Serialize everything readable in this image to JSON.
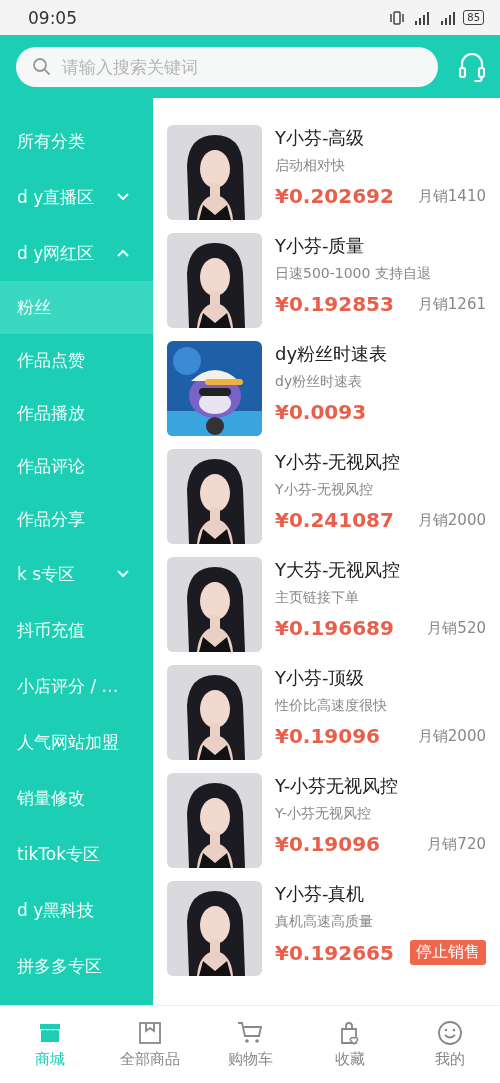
{
  "status_bar": {
    "time": "09:05",
    "battery": "85"
  },
  "search": {
    "placeholder": "请输入搜索关键词"
  },
  "sidebar": {
    "items": [
      {
        "label": "所有分类",
        "selected": false
      },
      {
        "label": "d y直播区",
        "selected": false,
        "expanded": false
      },
      {
        "label": "d y网红区",
        "selected": false,
        "expanded": true,
        "children": [
          {
            "label": "粉丝",
            "selected": true
          },
          {
            "label": "作品点赞",
            "selected": false
          },
          {
            "label": "作品播放",
            "selected": false
          },
          {
            "label": "作品评论",
            "selected": false
          },
          {
            "label": "作品分享",
            "selected": false
          }
        ]
      },
      {
        "label": "k s专区",
        "selected": false,
        "expanded": false
      },
      {
        "label": "抖币充值",
        "selected": false
      },
      {
        "label": "小店评分 / …",
        "selected": false
      },
      {
        "label": "人气网站加盟",
        "selected": false
      },
      {
        "label": "销量修改",
        "selected": false
      },
      {
        "label": "tikTok专区",
        "selected": false
      },
      {
        "label": "d y黑科技",
        "selected": false
      },
      {
        "label": "拼多多专区",
        "selected": false
      }
    ]
  },
  "products": [
    {
      "title": "Y小芬-高级",
      "subtitle": "启动相对快",
      "price": "¥0.202692",
      "sales": "月销1410"
    },
    {
      "title": "Y小芬-质量",
      "subtitle": "日速500-1000 支持自退",
      "price": "¥0.192853",
      "sales": "月销1261"
    },
    {
      "title": "dy粉丝时速表",
      "subtitle": "dy粉丝时速表",
      "price": "¥0.0093"
    },
    {
      "title": "Y小芬-无视风控",
      "subtitle": "Y小芬-无视风控",
      "price": "¥0.241087",
      "sales": "月销2000"
    },
    {
      "title": "Y大芬-无视风控",
      "subtitle": "主页链接下单",
      "price": "¥0.196689",
      "sales": "月销520"
    },
    {
      "title": "Y小芬-顶级",
      "subtitle": "性价比高速度很快",
      "price": "¥0.19096",
      "sales": "月销2000"
    },
    {
      "title": "Y-小芬无视风控",
      "subtitle": "Y-小芬无视风控",
      "price": "¥0.19096",
      "sales": "月销720"
    },
    {
      "title": "Y小芬-真机",
      "subtitle": "真机高速高质量",
      "price": "¥0.192665",
      "badge": "停止销售"
    }
  ],
  "tab_bar": [
    {
      "label": "商城",
      "selected": true
    },
    {
      "label": "全部商品",
      "selected": false
    },
    {
      "label": "购物车",
      "selected": false
    },
    {
      "label": "收藏",
      "selected": false
    },
    {
      "label": "我的",
      "selected": false
    }
  ]
}
